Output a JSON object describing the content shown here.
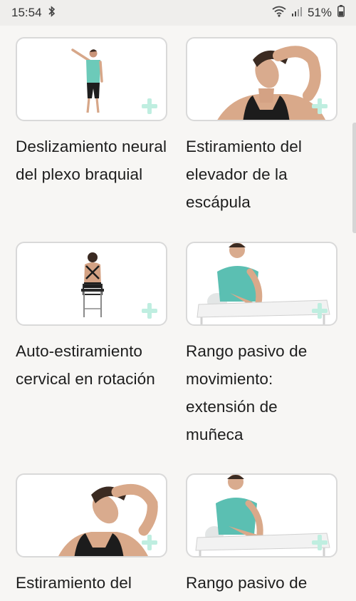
{
  "status_bar": {
    "time": "15:54",
    "battery": "51%",
    "icons": [
      "bluetooth-icon",
      "wifi-icon",
      "signal-icon",
      "battery-icon"
    ]
  },
  "exercises": [
    {
      "title": "Deslizamiento neural del plexo braquial",
      "image": "woman-arm-raised-standing"
    },
    {
      "title": "Estiramiento del elevador de la escápula",
      "image": "woman-neck-stretch"
    },
    {
      "title": "Auto-estiramiento cervical en rotación",
      "image": "woman-seated-back-view"
    },
    {
      "title": "Rango pasivo de movimiento: extensión de muñeca",
      "image": "woman-seated-at-table"
    },
    {
      "title": "Estiramiento del",
      "image": "woman-neck-stretch"
    },
    {
      "title": "Rango pasivo de",
      "image": "woman-seated-at-table"
    }
  ],
  "colors": {
    "background": "#f7f6f4",
    "plus_accent": "#bfeee0",
    "shirt_teal": "#5bbfb2"
  }
}
